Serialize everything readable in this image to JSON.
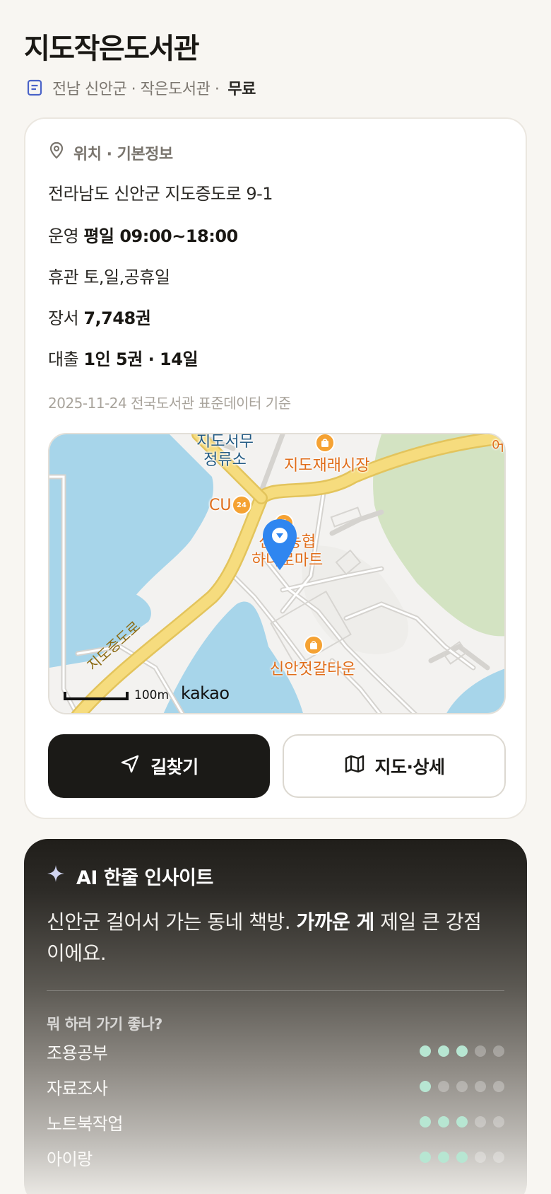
{
  "header": {
    "title": "지도작은도서관",
    "meta_region": "전남 신안군 · 작은도서관 ·",
    "meta_fee": "무료"
  },
  "info": {
    "section_title": "위치 · 기본정보",
    "address": "전라남도 신안군 지도증도로 9-1",
    "hours_label": "운영",
    "hours_value": "평일 09:00~18:00",
    "closed_label": "휴관",
    "closed_value": "토,일,공휴일",
    "books_label": "장서",
    "books_value": "7,748권",
    "loan_label": "대출",
    "loan_value": "1인 5권 · 14일",
    "source": "2025-11-24 전국도서관 표준데이터 기준"
  },
  "map": {
    "labels": {
      "bus_stop_line1": "지도서무",
      "bus_stop_line2": "정류소",
      "market": "지도재래시장",
      "cu": "CU",
      "mart_line1": "신안농협",
      "mart_line2": "하나로마트",
      "fish_town": "신안젓갈타운",
      "road": "지도증도로",
      "edge": "어"
    },
    "scale": "100m",
    "provider": "kakao"
  },
  "actions": {
    "directions": "길찾기",
    "map_detail": "지도·상세"
  },
  "ai": {
    "title": "AI 한줄 인사이트",
    "text_before": "신안군 걸어서 가는 동네 책방. ",
    "text_bold": "가까운 게",
    "text_after": " 제일 큰 강점이에요.",
    "question": "뭐 하러 가기 좋나?",
    "ratings": [
      {
        "label": "조용공부",
        "score": 3,
        "max": 5
      },
      {
        "label": "자료조사",
        "score": 1,
        "max": 5
      },
      {
        "label": "노트북작업",
        "score": 3,
        "max": 5
      },
      {
        "label": "아이랑",
        "score": 3,
        "max": 5
      }
    ]
  },
  "colors": {
    "accent_dark": "#1b1a17",
    "dot_on": "#b7e6d2",
    "poi_orange": "#f5a233",
    "pin_blue": "#2f86f0",
    "water": "#a7d5ea",
    "park": "#d3e3c2",
    "road": "#f6dc7e"
  }
}
